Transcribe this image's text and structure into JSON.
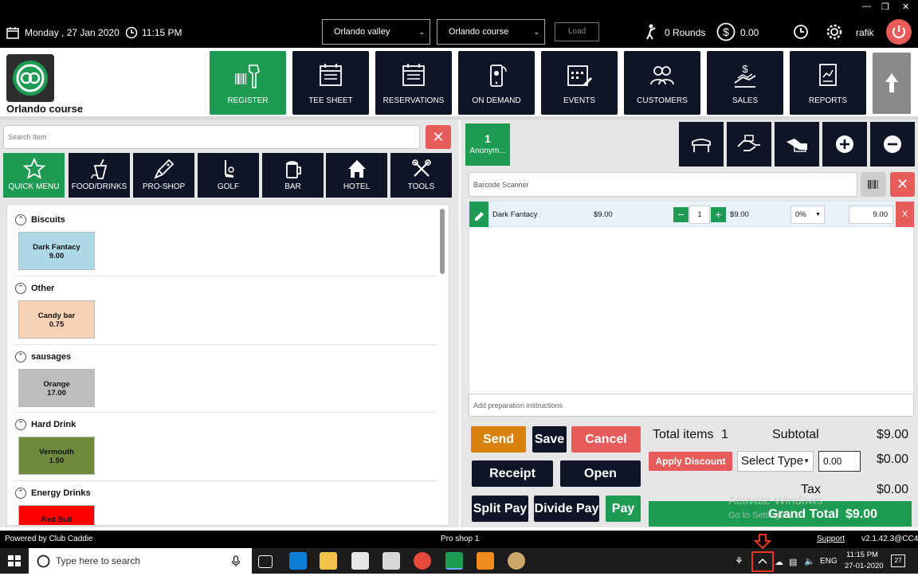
{
  "topbar": {
    "date": "Monday , 27 Jan 2020",
    "time": "11:15 PM",
    "location_select": "Orlando valley",
    "course_select": "Orlando course",
    "load_label": "Load",
    "rounds": "0 Rounds",
    "money": "0.00",
    "username": "rafik"
  },
  "brand": {
    "course_name": "Orlando course"
  },
  "nav": [
    {
      "label": "REGISTER"
    },
    {
      "label": "TEE SHEET"
    },
    {
      "label": "RESERVATIONS"
    },
    {
      "label": "ON DEMAND"
    },
    {
      "label": "EVENTS"
    },
    {
      "label": "CUSTOMERS"
    },
    {
      "label": "SALES"
    },
    {
      "label": "REPORTS"
    }
  ],
  "search": {
    "placeholder": "Search Item"
  },
  "categories": [
    {
      "label": "QUICK MENU"
    },
    {
      "label": "FOOD/DRINKS"
    },
    {
      "label": "PRO-SHOP"
    },
    {
      "label": "GOLF"
    },
    {
      "label": "BAR"
    },
    {
      "label": "HOTEL"
    },
    {
      "label": "TOOLS"
    }
  ],
  "groups": [
    {
      "name": "Biscuits",
      "item": "Dark Fantacy",
      "price": "9.00",
      "color": "#add8e6"
    },
    {
      "name": "Other",
      "item": "Candy bar",
      "price": "0.75",
      "color": "#f8d2b4"
    },
    {
      "name": "sausages",
      "item": "Orange",
      "price": "17.00",
      "color": "#bdbdbd"
    },
    {
      "name": "Hard Drink",
      "item": "Vermouth",
      "price": "1.50",
      "color": "#6e8b3d"
    },
    {
      "name": "Energy Drinks",
      "item": "Red Bull",
      "price": "",
      "color": "#ff0000"
    }
  ],
  "customer": {
    "count": "1",
    "name": "Anonym..."
  },
  "barcode": {
    "placeholder": "Barcode Scanner"
  },
  "cart": [
    {
      "name": "Dark Fantacy",
      "price": "$9.00",
      "qty": "1",
      "line_price": "$9.00",
      "discount": "0%",
      "amount": "9.00"
    }
  ],
  "prep": {
    "placeholder": "Add preparation instructions"
  },
  "buttons": {
    "send": "Send",
    "save": "Save",
    "cancel": "Cancel",
    "receipt": "Receipt",
    "open": "Open",
    "split_pay": "Split Pay",
    "divide_pay": "Divide Pay",
    "pay": "Pay",
    "apply_discount": "Apply Discount"
  },
  "totals": {
    "total_items_label": "Total items",
    "total_items": "1",
    "subtotal_label": "Subtotal",
    "subtotal": "$9.00",
    "discount_type": "Select Type",
    "discount_value": "0.00",
    "discount_amount": "$0.00",
    "tax_label": "Tax",
    "tax": "$0.00",
    "grand_total_label": "Grand Total",
    "grand_total": "$9.00"
  },
  "watermark": {
    "line1": "Activate Windows",
    "line2": "Go to Settings to activate Windows."
  },
  "status": {
    "powered": "Powered by Club Caddie",
    "shop": "Pro shop 1",
    "support": "Support",
    "version": "v2.1.42.3@CC4"
  },
  "taskbar": {
    "search": "Type here to search",
    "lang": "ENG",
    "time": "11:15 PM",
    "date": "27-01-2020",
    "notif": "27"
  },
  "colors": {
    "green": "#1e9b52",
    "navy": "#0f1527",
    "red": "#e85b5b",
    "orange": "#d9820f"
  }
}
